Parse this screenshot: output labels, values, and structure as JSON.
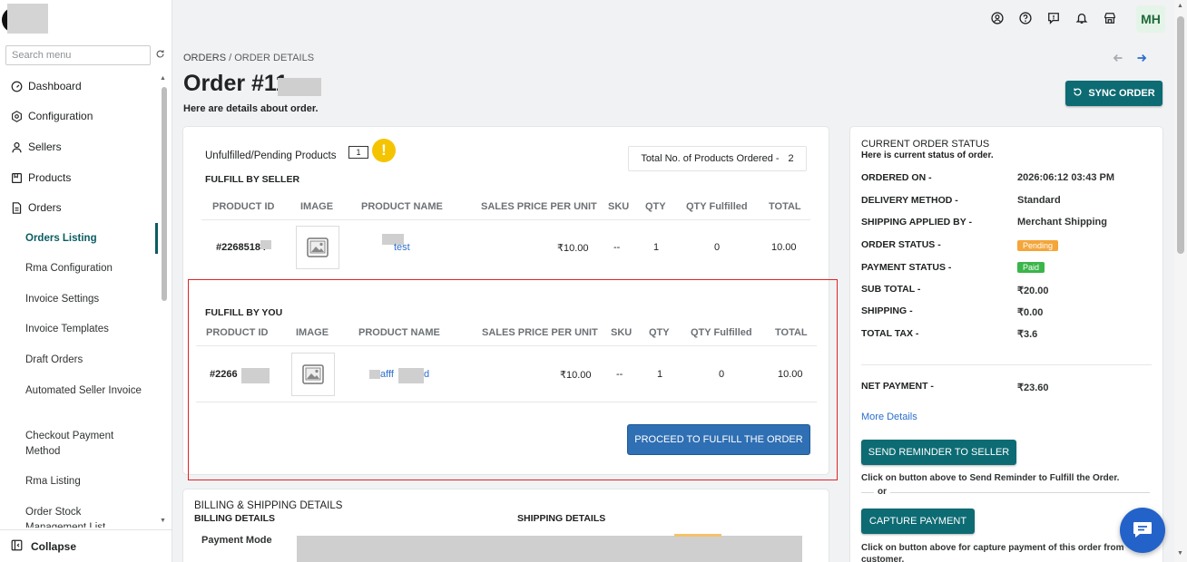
{
  "sidebar": {
    "search_placeholder": "Search menu",
    "items": [
      {
        "label": "Dashboard",
        "icon": "dashboard-icon"
      },
      {
        "label": "Configuration",
        "icon": "configuration-icon"
      },
      {
        "label": "Sellers",
        "icon": "user-icon"
      },
      {
        "label": "Products",
        "icon": "products-icon"
      },
      {
        "label": "Orders",
        "icon": "orders-icon"
      }
    ],
    "subitems": [
      "Orders Listing",
      "Rma Configuration",
      "Invoice Settings",
      "Invoice Templates",
      "Draft Orders",
      "Automated Seller Invoice",
      "Checkout Payment Method",
      "Rma Listing",
      "Order Stock Management List"
    ],
    "collapse_label": "Collapse"
  },
  "topbar": {
    "icons": [
      "user-circle-icon",
      "help-icon",
      "feedback-icon",
      "bell-icon",
      "store-icon"
    ],
    "avatar_initials": "MH"
  },
  "header": {
    "breadcrumb_root": "ORDERS",
    "breadcrumb_sep": " / ",
    "breadcrumb_current": "ORDER DETAILS",
    "title": "Order #11",
    "subtitle": "Here are details about order.",
    "sync_label": "SYNC ORDER"
  },
  "unfulfilled": {
    "label": "Unfulfilled/Pending Products",
    "count": "1",
    "total_label": "Total No. of Products Ordered -",
    "total_value": "2"
  },
  "seller_section": {
    "heading": "FULFILL BY SELLER",
    "columns": [
      "PRODUCT ID",
      "IMAGE",
      "PRODUCT NAME",
      "SALES PRICE PER UNIT",
      "SKU",
      "QTY",
      "QTY Fulfilled",
      "TOTAL"
    ],
    "row": {
      "product_id": "#22685184",
      "product_name": "test",
      "price": "₹10.00",
      "sku": "--",
      "qty": "1",
      "qty_fulfilled": "0",
      "total": "10.00"
    }
  },
  "you_section": {
    "heading": "FULFILL BY YOU",
    "columns": [
      "PRODUCT ID",
      "IMAGE",
      "PRODUCT NAME",
      "SALES PRICE PER UNIT",
      "SKU",
      "QTY",
      "QTY Fulfilled",
      "TOTAL"
    ],
    "row": {
      "product_id": "#2266",
      "product_name_a": "afff",
      "product_name_b": "d",
      "price": "₹10.00",
      "sku": "--",
      "qty": "1",
      "qty_fulfilled": "0",
      "total": "10.00"
    },
    "proceed_label": "PROCEED TO FULFILL THE ORDER"
  },
  "billing": {
    "heading": "BILLING & SHIPPING DETAILS",
    "billing_title": "BILLING DETAILS",
    "shipping_title": "SHIPPING DETAILS",
    "payment_mode_label": "Payment Mode"
  },
  "status": {
    "title": "CURRENT ORDER STATUS",
    "subtitle": "Here is current status of order.",
    "rows": [
      {
        "label": "ORDERED ON -",
        "value": "2026:06:12 03:43 PM"
      },
      {
        "label": "DELIVERY METHOD -",
        "value": "Standard"
      },
      {
        "label": "SHIPPING APPLIED BY -",
        "value": "Merchant Shipping"
      },
      {
        "label": "ORDER STATUS -",
        "value": "Pending"
      },
      {
        "label": "PAYMENT STATUS -",
        "value": "Paid"
      },
      {
        "label": "SUB TOTAL -",
        "value": "₹20.00"
      },
      {
        "label": "SHIPPING -",
        "value": "₹0.00"
      },
      {
        "label": "TOTAL TAX -",
        "value": "₹3.6"
      }
    ],
    "net_label": "NET PAYMENT -",
    "net_value": "₹23.60",
    "more_details": "More Details",
    "reminder_label": "SEND REMINDER TO SELLER",
    "reminder_note": "Click on button above to Send Reminder to Fulfill the Order.",
    "or_text": "or",
    "capture_label": "CAPTURE PAYMENT",
    "capture_note": "Click on button above for capture payment of this order from customer."
  },
  "colors": {
    "accent": "#0d6b73",
    "link": "#2c6ecb",
    "pending": "#f4a63a",
    "paid": "#3bb54a",
    "warning": "#f5c400"
  }
}
